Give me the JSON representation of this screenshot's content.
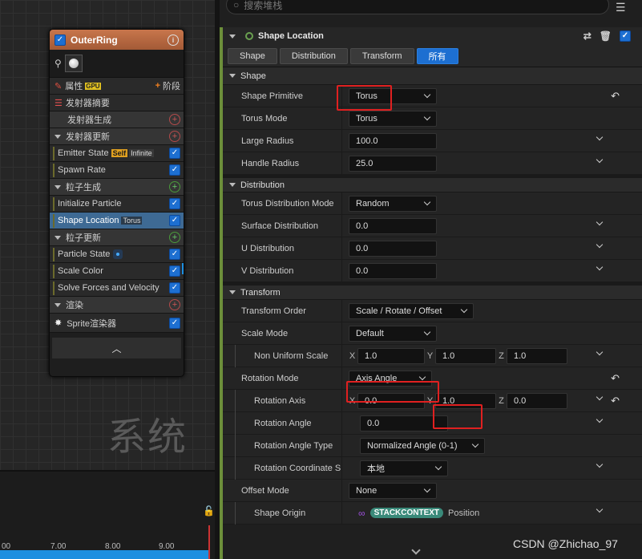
{
  "emitter": {
    "title": "OuterRing",
    "tabs": {
      "properties": "属性",
      "gpu": "GPU",
      "stage": "阶段"
    },
    "summary": "发射器摘要",
    "sections": [
      {
        "label": "发射器生成",
        "items": []
      },
      {
        "label": "发射器更新",
        "items": [
          {
            "label": "Emitter State",
            "badges": [
              "Self",
              "Infinite"
            ]
          },
          {
            "label": "Spawn Rate",
            "badges": []
          }
        ]
      },
      {
        "label": "粒子生成",
        "items": [
          {
            "label": "Initialize Particle",
            "badges": []
          },
          {
            "label": "Shape Location",
            "badges": [
              "Torus"
            ]
          }
        ]
      },
      {
        "label": "粒子更新",
        "items": [
          {
            "label": "Particle State",
            "badges": []
          },
          {
            "label": "Scale Color",
            "badges": []
          },
          {
            "label": "Solve Forces and Velocity",
            "badges": []
          }
        ]
      },
      {
        "label": "渲染",
        "items": [
          {
            "label": "Sprite渲染器",
            "badges": []
          }
        ]
      }
    ]
  },
  "watermark_text": "系统",
  "timeline": {
    "ticks": [
      "00",
      "7.00",
      "8.00",
      "9.00"
    ]
  },
  "search": {
    "placeholder": "搜索堆栈"
  },
  "details": {
    "module_title": "Shape Location",
    "tabs": [
      {
        "label": "Shape",
        "active": false
      },
      {
        "label": "Distribution",
        "active": false
      },
      {
        "label": "Transform",
        "active": false
      },
      {
        "label": "所有",
        "active": true
      }
    ],
    "categories": {
      "shape": "Shape",
      "distribution": "Distribution",
      "transform": "Transform"
    },
    "shape": {
      "primitive": {
        "label": "Shape Primitive",
        "value": "Torus"
      },
      "torus_mode": {
        "label": "Torus Mode",
        "value": "Torus"
      },
      "large_radius": {
        "label": "Large Radius",
        "value": "100.0"
      },
      "handle_radius": {
        "label": "Handle Radius",
        "value": "25.0"
      }
    },
    "distribution": {
      "mode": {
        "label": "Torus Distribution Mode",
        "value": "Random"
      },
      "surface": {
        "label": "Surface Distribution",
        "value": "0.0"
      },
      "u": {
        "label": "U Distribution",
        "value": "0.0"
      },
      "v": {
        "label": "V Distribution",
        "value": "0.0"
      }
    },
    "transform": {
      "order": {
        "label": "Transform Order",
        "value": "Scale / Rotate / Offset"
      },
      "scale_mode": {
        "label": "Scale Mode",
        "value": "Default"
      },
      "non_uniform_scale": {
        "label": "Non Uniform Scale",
        "x": "1.0",
        "y": "1.0",
        "z": "1.0"
      },
      "rotation_mode": {
        "label": "Rotation Mode",
        "value": "Axis Angle"
      },
      "rotation_axis": {
        "label": "Rotation Axis",
        "x": "0.0",
        "y": "1.0",
        "z": "0.0"
      },
      "rotation_angle": {
        "label": "Rotation Angle",
        "value": "0.0"
      },
      "rotation_angle_type": {
        "label": "Rotation Angle Type",
        "value": "Normalized Angle (0-1)"
      },
      "rotation_coordinate": {
        "label": "Rotation Coordinate S",
        "value": "本地"
      },
      "offset_mode": {
        "label": "Offset Mode",
        "value": "None"
      },
      "shape_origin": {
        "label": "Shape Origin",
        "tag": "STACKCONTEXT",
        "value": "Position"
      }
    },
    "axis_labels": {
      "x": "X",
      "y": "Y",
      "z": "Z"
    }
  },
  "watermark_csdn": "CSDN @Zhichao_97",
  "colors": {
    "accent": "#1d6fd1",
    "header": "#b8673f",
    "highlight_box": "#e02020"
  }
}
